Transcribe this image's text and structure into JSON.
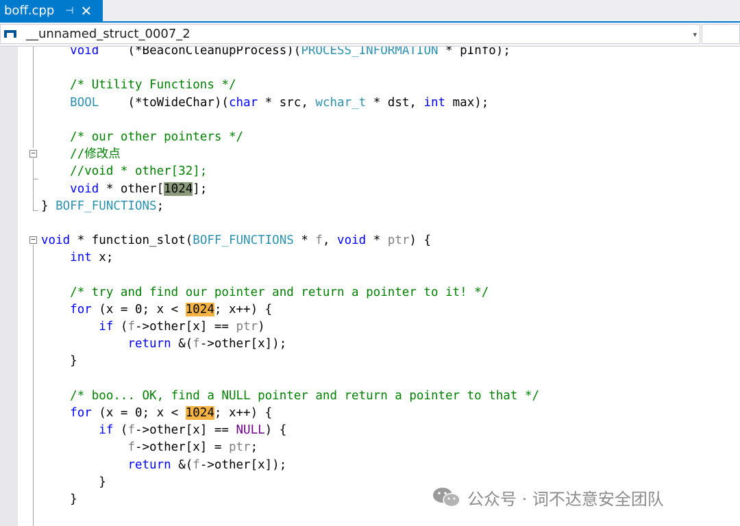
{
  "tab": {
    "title": "boff.cpp",
    "pin_glyph": "⊣",
    "close_glyph": "✕"
  },
  "navbar": {
    "scope": "__unnamed_struct_0007_2",
    "dropdown_glyph": "▾"
  },
  "editor": {
    "lines": [
      [
        {
          "t": "    "
        },
        {
          "t": "void",
          "c": "kw"
        },
        {
          "t": "    (*BeaconCleanupProcess)("
        },
        {
          "t": "PROCESS_INFORMATION",
          "c": "ty"
        },
        {
          "t": " * pInfo);"
        }
      ],
      [],
      [
        {
          "t": "    "
        },
        {
          "t": "/* Utility Functions */",
          "c": "cm"
        }
      ],
      [
        {
          "t": "    "
        },
        {
          "t": "BOOL",
          "c": "ty"
        },
        {
          "t": "    (*toWideChar)("
        },
        {
          "t": "char",
          "c": "kw"
        },
        {
          "t": " * src, "
        },
        {
          "t": "wchar_t",
          "c": "ty"
        },
        {
          "t": " * dst, "
        },
        {
          "t": "int",
          "c": "kw"
        },
        {
          "t": " max);"
        }
      ],
      [],
      [
        {
          "t": "    "
        },
        {
          "t": "/* our other pointers */",
          "c": "cm"
        }
      ],
      [
        {
          "t": "    "
        },
        {
          "t": "//修改点",
          "c": "cm"
        }
      ],
      [
        {
          "t": "    "
        },
        {
          "t": "//void * other[32];",
          "c": "cm"
        }
      ],
      [
        {
          "t": "    "
        },
        {
          "t": "void",
          "c": "kw"
        },
        {
          "t": " * other["
        },
        {
          "t": "1024",
          "c": "hl-gray"
        },
        {
          "t": "];"
        }
      ],
      [
        {
          "t": "} "
        },
        {
          "t": "BOFF_FUNCTIONS",
          "c": "ty"
        },
        {
          "t": ";"
        }
      ],
      [],
      [
        {
          "t": "void",
          "c": "kw"
        },
        {
          "t": " * function_slot("
        },
        {
          "t": "BOFF_FUNCTIONS",
          "c": "ty"
        },
        {
          "t": " * "
        },
        {
          "t": "f",
          "c": "pm"
        },
        {
          "t": ", "
        },
        {
          "t": "void",
          "c": "kw"
        },
        {
          "t": " * "
        },
        {
          "t": "ptr",
          "c": "pm"
        },
        {
          "t": ") {"
        }
      ],
      [
        {
          "t": "    "
        },
        {
          "t": "int",
          "c": "kw"
        },
        {
          "t": " x;"
        }
      ],
      [],
      [
        {
          "t": "    "
        },
        {
          "t": "/* try and find our pointer and return a pointer to it! */",
          "c": "cm"
        }
      ],
      [
        {
          "t": "    "
        },
        {
          "t": "for",
          "c": "kw"
        },
        {
          "t": " (x = 0; x < "
        },
        {
          "t": "1024",
          "c": "hl-orange"
        },
        {
          "t": "; x++) {"
        }
      ],
      [
        {
          "t": "        "
        },
        {
          "t": "if",
          "c": "kw"
        },
        {
          "t": " ("
        },
        {
          "t": "f",
          "c": "pm"
        },
        {
          "t": "->other[x] == "
        },
        {
          "t": "ptr",
          "c": "pm"
        },
        {
          "t": ")"
        }
      ],
      [
        {
          "t": "            "
        },
        {
          "t": "return",
          "c": "kw"
        },
        {
          "t": " &("
        },
        {
          "t": "f",
          "c": "pm"
        },
        {
          "t": "->other[x]);"
        }
      ],
      [
        {
          "t": "    }"
        }
      ],
      [],
      [
        {
          "t": "    "
        },
        {
          "t": "/* boo... OK, find a NULL pointer and return a pointer to that */",
          "c": "cm"
        }
      ],
      [
        {
          "t": "    "
        },
        {
          "t": "for",
          "c": "kw"
        },
        {
          "t": " (x = 0; x < "
        },
        {
          "t": "1024",
          "c": "hl-orange"
        },
        {
          "t": "; x++) {"
        }
      ],
      [
        {
          "t": "        "
        },
        {
          "t": "if",
          "c": "kw"
        },
        {
          "t": " ("
        },
        {
          "t": "f",
          "c": "pm"
        },
        {
          "t": "->other[x] == "
        },
        {
          "t": "NULL",
          "c": "mac"
        },
        {
          "t": ") {"
        }
      ],
      [
        {
          "t": "            "
        },
        {
          "t": "f",
          "c": "pm"
        },
        {
          "t": "->other[x] = "
        },
        {
          "t": "ptr",
          "c": "pm"
        },
        {
          "t": ";"
        }
      ],
      [
        {
          "t": "            "
        },
        {
          "t": "return",
          "c": "kw"
        },
        {
          "t": " &("
        },
        {
          "t": "f",
          "c": "pm"
        },
        {
          "t": "->other[x]);"
        }
      ],
      [
        {
          "t": "        }"
        }
      ],
      [
        {
          "t": "    }"
        }
      ],
      []
    ],
    "outline_collapse_glyph": "−"
  },
  "watermark": {
    "text": "公众号 · 词不达意安全团队"
  },
  "colors": {
    "accent": "#007acc",
    "keyword": "#0000ff",
    "type": "#2b91af",
    "comment": "#008000",
    "parameter": "#808080",
    "macro": "#6f008a",
    "highlight_reference": "#8a9a7b",
    "highlight_match": "#f5b343"
  }
}
